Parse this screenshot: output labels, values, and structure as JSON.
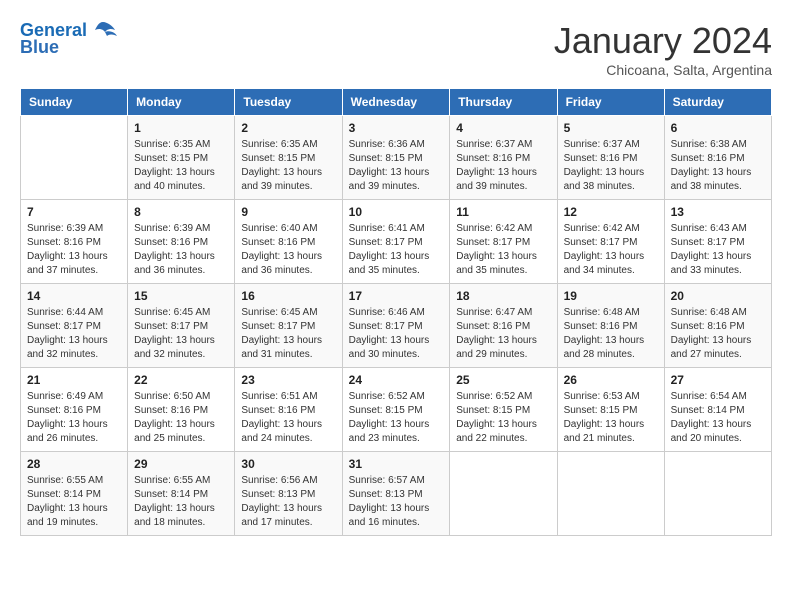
{
  "logo": {
    "line1": "General",
    "line2": "Blue"
  },
  "title": "January 2024",
  "subtitle": "Chicoana, Salta, Argentina",
  "weekdays": [
    "Sunday",
    "Monday",
    "Tuesday",
    "Wednesday",
    "Thursday",
    "Friday",
    "Saturday"
  ],
  "weeks": [
    [
      {
        "day": "",
        "sunrise": "",
        "sunset": "",
        "daylight": ""
      },
      {
        "day": "1",
        "sunrise": "Sunrise: 6:35 AM",
        "sunset": "Sunset: 8:15 PM",
        "daylight": "Daylight: 13 hours and 40 minutes."
      },
      {
        "day": "2",
        "sunrise": "Sunrise: 6:35 AM",
        "sunset": "Sunset: 8:15 PM",
        "daylight": "Daylight: 13 hours and 39 minutes."
      },
      {
        "day": "3",
        "sunrise": "Sunrise: 6:36 AM",
        "sunset": "Sunset: 8:15 PM",
        "daylight": "Daylight: 13 hours and 39 minutes."
      },
      {
        "day": "4",
        "sunrise": "Sunrise: 6:37 AM",
        "sunset": "Sunset: 8:16 PM",
        "daylight": "Daylight: 13 hours and 39 minutes."
      },
      {
        "day": "5",
        "sunrise": "Sunrise: 6:37 AM",
        "sunset": "Sunset: 8:16 PM",
        "daylight": "Daylight: 13 hours and 38 minutes."
      },
      {
        "day": "6",
        "sunrise": "Sunrise: 6:38 AM",
        "sunset": "Sunset: 8:16 PM",
        "daylight": "Daylight: 13 hours and 38 minutes."
      }
    ],
    [
      {
        "day": "7",
        "sunrise": "Sunrise: 6:39 AM",
        "sunset": "Sunset: 8:16 PM",
        "daylight": "Daylight: 13 hours and 37 minutes."
      },
      {
        "day": "8",
        "sunrise": "Sunrise: 6:39 AM",
        "sunset": "Sunset: 8:16 PM",
        "daylight": "Daylight: 13 hours and 36 minutes."
      },
      {
        "day": "9",
        "sunrise": "Sunrise: 6:40 AM",
        "sunset": "Sunset: 8:16 PM",
        "daylight": "Daylight: 13 hours and 36 minutes."
      },
      {
        "day": "10",
        "sunrise": "Sunrise: 6:41 AM",
        "sunset": "Sunset: 8:17 PM",
        "daylight": "Daylight: 13 hours and 35 minutes."
      },
      {
        "day": "11",
        "sunrise": "Sunrise: 6:42 AM",
        "sunset": "Sunset: 8:17 PM",
        "daylight": "Daylight: 13 hours and 35 minutes."
      },
      {
        "day": "12",
        "sunrise": "Sunrise: 6:42 AM",
        "sunset": "Sunset: 8:17 PM",
        "daylight": "Daylight: 13 hours and 34 minutes."
      },
      {
        "day": "13",
        "sunrise": "Sunrise: 6:43 AM",
        "sunset": "Sunset: 8:17 PM",
        "daylight": "Daylight: 13 hours and 33 minutes."
      }
    ],
    [
      {
        "day": "14",
        "sunrise": "Sunrise: 6:44 AM",
        "sunset": "Sunset: 8:17 PM",
        "daylight": "Daylight: 13 hours and 32 minutes."
      },
      {
        "day": "15",
        "sunrise": "Sunrise: 6:45 AM",
        "sunset": "Sunset: 8:17 PM",
        "daylight": "Daylight: 13 hours and 32 minutes."
      },
      {
        "day": "16",
        "sunrise": "Sunrise: 6:45 AM",
        "sunset": "Sunset: 8:17 PM",
        "daylight": "Daylight: 13 hours and 31 minutes."
      },
      {
        "day": "17",
        "sunrise": "Sunrise: 6:46 AM",
        "sunset": "Sunset: 8:17 PM",
        "daylight": "Daylight: 13 hours and 30 minutes."
      },
      {
        "day": "18",
        "sunrise": "Sunrise: 6:47 AM",
        "sunset": "Sunset: 8:16 PM",
        "daylight": "Daylight: 13 hours and 29 minutes."
      },
      {
        "day": "19",
        "sunrise": "Sunrise: 6:48 AM",
        "sunset": "Sunset: 8:16 PM",
        "daylight": "Daylight: 13 hours and 28 minutes."
      },
      {
        "day": "20",
        "sunrise": "Sunrise: 6:48 AM",
        "sunset": "Sunset: 8:16 PM",
        "daylight": "Daylight: 13 hours and 27 minutes."
      }
    ],
    [
      {
        "day": "21",
        "sunrise": "Sunrise: 6:49 AM",
        "sunset": "Sunset: 8:16 PM",
        "daylight": "Daylight: 13 hours and 26 minutes."
      },
      {
        "day": "22",
        "sunrise": "Sunrise: 6:50 AM",
        "sunset": "Sunset: 8:16 PM",
        "daylight": "Daylight: 13 hours and 25 minutes."
      },
      {
        "day": "23",
        "sunrise": "Sunrise: 6:51 AM",
        "sunset": "Sunset: 8:16 PM",
        "daylight": "Daylight: 13 hours and 24 minutes."
      },
      {
        "day": "24",
        "sunrise": "Sunrise: 6:52 AM",
        "sunset": "Sunset: 8:15 PM",
        "daylight": "Daylight: 13 hours and 23 minutes."
      },
      {
        "day": "25",
        "sunrise": "Sunrise: 6:52 AM",
        "sunset": "Sunset: 8:15 PM",
        "daylight": "Daylight: 13 hours and 22 minutes."
      },
      {
        "day": "26",
        "sunrise": "Sunrise: 6:53 AM",
        "sunset": "Sunset: 8:15 PM",
        "daylight": "Daylight: 13 hours and 21 minutes."
      },
      {
        "day": "27",
        "sunrise": "Sunrise: 6:54 AM",
        "sunset": "Sunset: 8:14 PM",
        "daylight": "Daylight: 13 hours and 20 minutes."
      }
    ],
    [
      {
        "day": "28",
        "sunrise": "Sunrise: 6:55 AM",
        "sunset": "Sunset: 8:14 PM",
        "daylight": "Daylight: 13 hours and 19 minutes."
      },
      {
        "day": "29",
        "sunrise": "Sunrise: 6:55 AM",
        "sunset": "Sunset: 8:14 PM",
        "daylight": "Daylight: 13 hours and 18 minutes."
      },
      {
        "day": "30",
        "sunrise": "Sunrise: 6:56 AM",
        "sunset": "Sunset: 8:13 PM",
        "daylight": "Daylight: 13 hours and 17 minutes."
      },
      {
        "day": "31",
        "sunrise": "Sunrise: 6:57 AM",
        "sunset": "Sunset: 8:13 PM",
        "daylight": "Daylight: 13 hours and 16 minutes."
      },
      {
        "day": "",
        "sunrise": "",
        "sunset": "",
        "daylight": ""
      },
      {
        "day": "",
        "sunrise": "",
        "sunset": "",
        "daylight": ""
      },
      {
        "day": "",
        "sunrise": "",
        "sunset": "",
        "daylight": ""
      }
    ]
  ]
}
